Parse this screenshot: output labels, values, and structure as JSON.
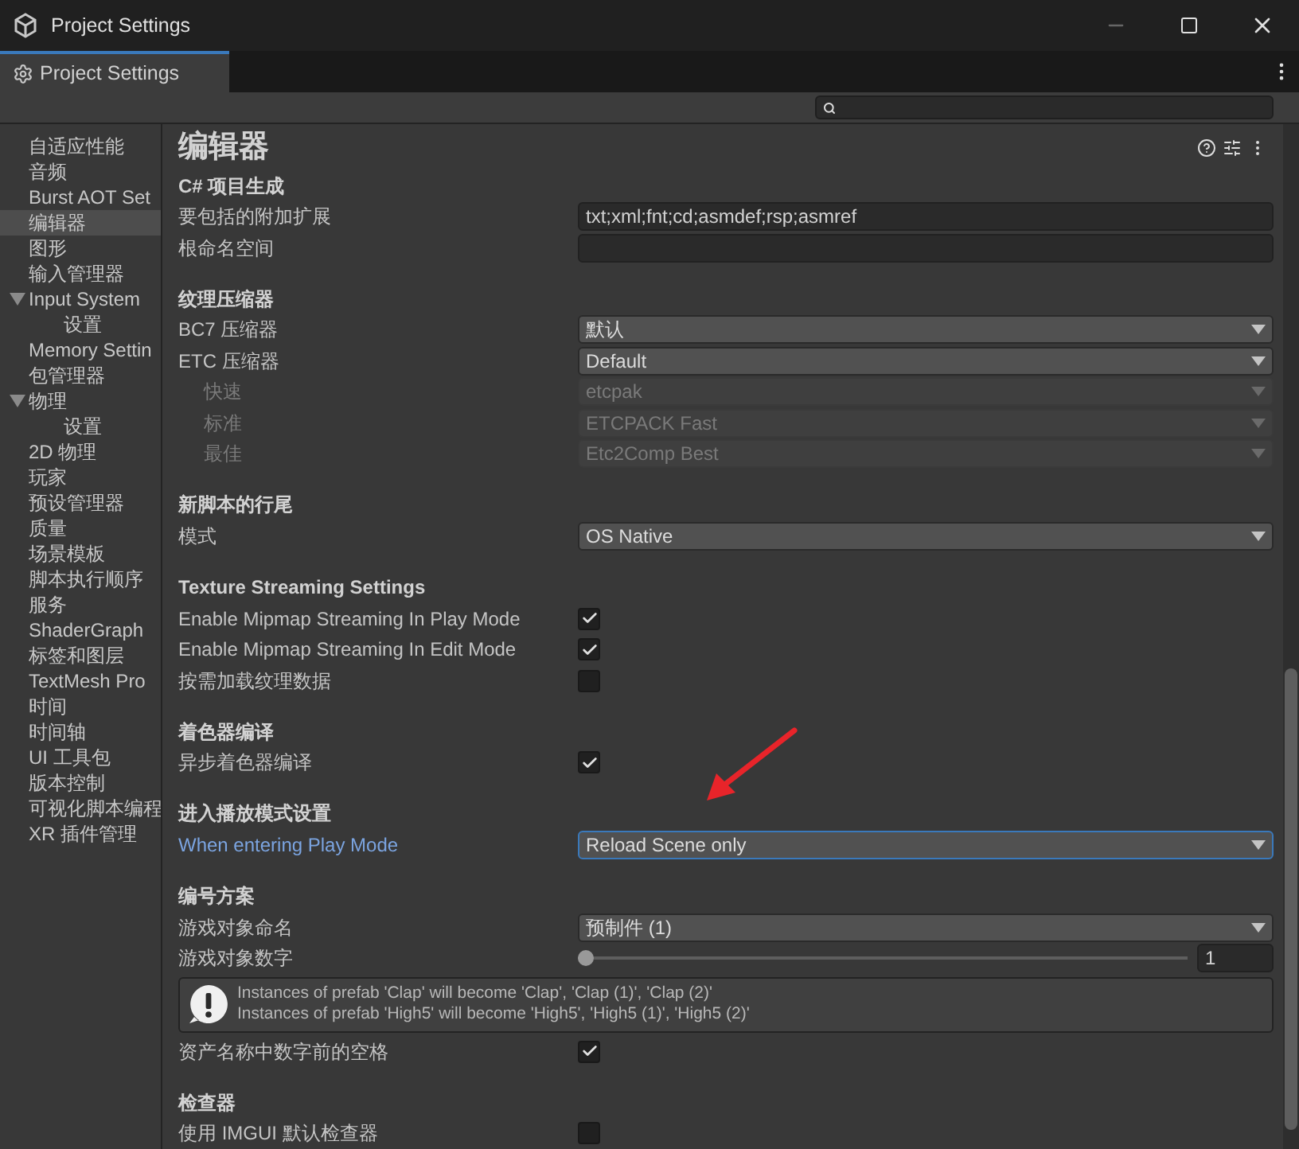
{
  "window": {
    "title": "Project Settings"
  },
  "tabs": [
    {
      "label": "Project Settings",
      "selected": true
    }
  ],
  "sidebar": {
    "items": [
      {
        "label": "自适应性能",
        "selected": false
      },
      {
        "label": "音频",
        "selected": false
      },
      {
        "label": "Burst AOT Set",
        "selected": false
      },
      {
        "label": "编辑器",
        "selected": true
      },
      {
        "label": "图形",
        "selected": false
      },
      {
        "label": "输入管理器",
        "selected": false
      },
      {
        "label": "Input System",
        "selected": false,
        "expanded": true,
        "children": [
          {
            "label": "设置",
            "selected": false
          }
        ]
      },
      {
        "label": "Memory Settin",
        "selected": false
      },
      {
        "label": "包管理器",
        "selected": false
      },
      {
        "label": "物理",
        "selected": false,
        "expanded": true,
        "children": [
          {
            "label": "设置",
            "selected": false
          }
        ]
      },
      {
        "label": "2D 物理",
        "selected": false
      },
      {
        "label": "玩家",
        "selected": false
      },
      {
        "label": "预设管理器",
        "selected": false
      },
      {
        "label": "质量",
        "selected": false
      },
      {
        "label": "场景模板",
        "selected": false
      },
      {
        "label": "脚本执行顺序",
        "selected": false
      },
      {
        "label": "服务",
        "selected": false
      },
      {
        "label": "ShaderGraph",
        "selected": false
      },
      {
        "label": "标签和图层",
        "selected": false
      },
      {
        "label": "TextMesh Pro",
        "selected": false
      },
      {
        "label": "时间",
        "selected": false
      },
      {
        "label": "时间轴",
        "selected": false
      },
      {
        "label": "UI 工具包",
        "selected": false
      },
      {
        "label": "版本控制",
        "selected": false
      },
      {
        "label": "可视化脚本编程",
        "selected": false
      },
      {
        "label": "XR 插件管理",
        "selected": false
      }
    ]
  },
  "page": {
    "title": "编辑器",
    "rows": [
      {
        "kind": "header",
        "label": "C# 项目生成"
      },
      {
        "kind": "text",
        "label": "要包括的附加扩展",
        "value": "txt;xml;fnt;cd;asmdef;rsp;asmref"
      },
      {
        "kind": "text",
        "label": "根命名空间"
      },
      {
        "kind": "space"
      },
      {
        "kind": "header",
        "label": "纹理压缩器"
      },
      {
        "kind": "dropdown",
        "label": "BC7 压缩器",
        "value": "默认",
        "disabled": false
      },
      {
        "kind": "dropdown",
        "label": "ETC 压缩器",
        "value": "Default",
        "disabled": false,
        "children": [
          {
            "kind": "dropdown",
            "label": "快速",
            "value": "etcpak",
            "disabled": true
          },
          {
            "kind": "dropdown",
            "label": "标准",
            "value": "ETCPACK Fast",
            "disabled": true
          },
          {
            "kind": "dropdown",
            "label": "最佳",
            "value": "Etc2Comp Best",
            "disabled": true
          }
        ]
      },
      {
        "kind": "space"
      },
      {
        "kind": "header",
        "label": "新脚本的行尾"
      },
      {
        "kind": "dropdown",
        "label": "模式",
        "value": "OS Native",
        "disabled": false
      },
      {
        "kind": "space"
      },
      {
        "kind": "header",
        "label": "Texture Streaming Settings"
      },
      {
        "kind": "checkbox",
        "label": "Enable Mipmap Streaming In Play Mode",
        "checked": true
      },
      {
        "kind": "checkbox",
        "label": "Enable Mipmap Streaming In Edit Mode",
        "checked": true
      },
      {
        "kind": "checkbox",
        "label": "按需加载纹理数据",
        "checked": false
      },
      {
        "kind": "space"
      },
      {
        "kind": "header",
        "label": "着色器编译"
      },
      {
        "kind": "checkbox",
        "label": "异步着色器编译",
        "checked": true
      },
      {
        "kind": "space"
      },
      {
        "kind": "header",
        "label": "进入播放模式设置"
      },
      {
        "kind": "dropdown",
        "label": "When entering Play Mode",
        "value": "Reload Scene only",
        "disabled": false,
        "focused": true
      },
      {
        "kind": "space"
      },
      {
        "kind": "header",
        "label": "编号方案"
      },
      {
        "kind": "dropdown",
        "label": "游戏对象命名",
        "value": "预制件 (1)",
        "disabled": false
      },
      {
        "kind": "slider",
        "label": "游戏对象数字",
        "value": "1",
        "level": 0
      },
      {
        "kind": "helpbox",
        "lines": [
          "Instances of prefab 'Clap' will become 'Clap', 'Clap (1)', 'Clap (2)'",
          "Instances of prefab 'High5' will become 'High5', 'High5 (1)', 'High5 (2)'"
        ]
      },
      {
        "kind": "checkbox",
        "label": "资产名称中数字前的空格",
        "checked": true
      },
      {
        "kind": "space"
      },
      {
        "kind": "header",
        "label": "检查器"
      },
      {
        "kind": "checkbox",
        "label": "使用 IMGUI 默认检查器",
        "checked": false
      }
    ]
  }
}
